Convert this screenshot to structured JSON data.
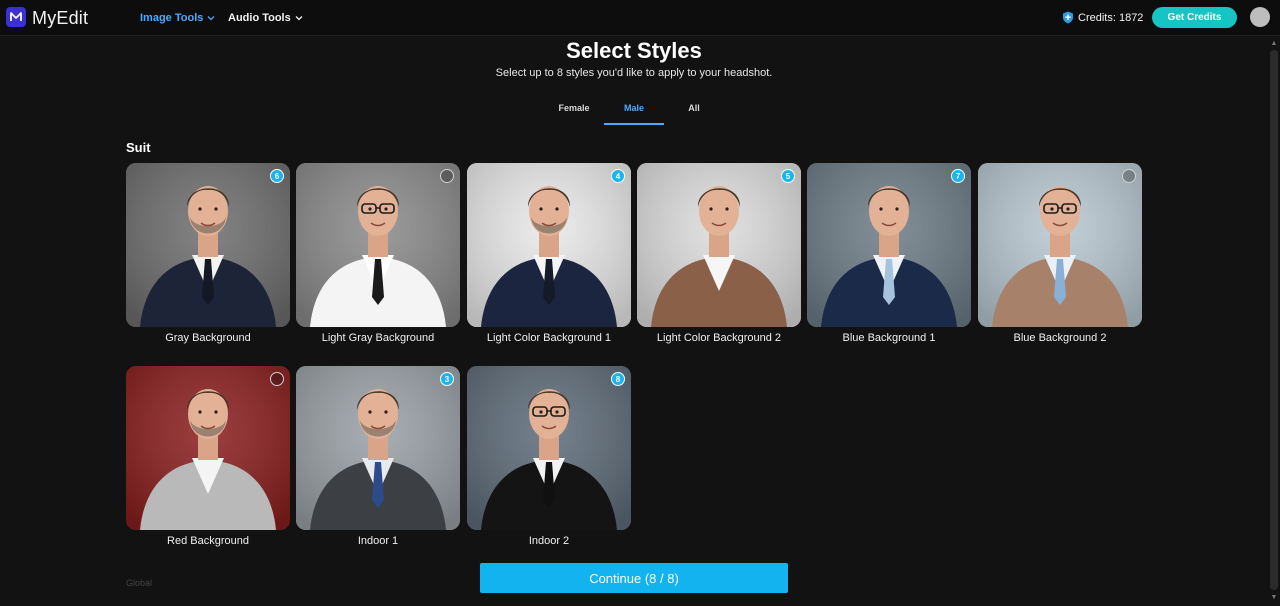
{
  "app": {
    "brand": "MyEdit"
  },
  "nav": {
    "image_tools": "Image Tools",
    "audio_tools": "Audio Tools"
  },
  "credits": {
    "text": "Credits: 1872",
    "button": "Get Credits"
  },
  "header": {
    "title": "Select Styles",
    "subtitle": "Select up to 8 styles you'd like to apply to your headshot."
  },
  "tabs": [
    {
      "label": "Female",
      "active": false
    },
    {
      "label": "Male",
      "active": true
    },
    {
      "label": "All",
      "active": false
    }
  ],
  "section": {
    "title": "Suit"
  },
  "next_section_hint": "Global",
  "styles": [
    {
      "label": "Gray Background",
      "selected": true,
      "order": "6",
      "bg": "#6e6e6e",
      "jacket": "#1d2438",
      "shirt": "#f2f2f2",
      "tie": "#141824",
      "beard": true,
      "glasses": false
    },
    {
      "label": "Light Gray Background",
      "selected": false,
      "order": "",
      "bg": "#8a8a8a",
      "jacket": "#f4f4f4",
      "shirt": "#ffffff",
      "tie": "#1a1a1a",
      "beard": false,
      "glasses": true
    },
    {
      "label": "Light Color Background 1",
      "selected": true,
      "order": "4",
      "bg": "#e9e9e9",
      "jacket": "#1b2540",
      "shirt": "#f4f4f4",
      "tie": "#151a2b",
      "beard": true,
      "glasses": false
    },
    {
      "label": "Light Color Background 2",
      "selected": true,
      "order": "5",
      "bg": "#dcdcdc",
      "jacket": "#8a6048",
      "shirt": "#f6f6f6",
      "tie": "",
      "beard": false,
      "glasses": false
    },
    {
      "label": "Blue Background 1",
      "selected": true,
      "order": "7",
      "bg": "#6d7c86",
      "jacket": "#1c2a4a",
      "shirt": "#eef2f6",
      "tie": "#a7c3db",
      "beard": false,
      "glasses": false
    },
    {
      "label": "Blue Background 2",
      "selected": false,
      "order": "",
      "bg": "#b8c7d0",
      "jacket": "#a8816a",
      "shirt": "#eaf0f5",
      "tie": "#8ab0d6",
      "beard": false,
      "glasses": true
    },
    {
      "label": "Red Background",
      "selected": false,
      "order": "",
      "bg": "#8a1e1e",
      "jacket": "#b9b9b9",
      "shirt": "#f4f4f4",
      "tie": "",
      "beard": true,
      "glasses": false
    },
    {
      "label": "Indoor 1",
      "selected": true,
      "order": "3",
      "bg": "#9aa0a6",
      "jacket": "#3c3f44",
      "shirt": "#e8eaee",
      "tie": "#2c4a8c",
      "beard": true,
      "glasses": false
    },
    {
      "label": "Indoor 2",
      "selected": true,
      "order": "8",
      "bg": "#5d6b78",
      "jacket": "#141414",
      "shirt": "#f2f2f2",
      "tie": "#101010",
      "beard": false,
      "glasses": true
    }
  ],
  "continue_button": "Continue (8 / 8)",
  "colors": {
    "accent": "#12b3ef",
    "link": "#4aa8ff",
    "credits_btn": "#16c4c4",
    "bg": "#121212"
  }
}
